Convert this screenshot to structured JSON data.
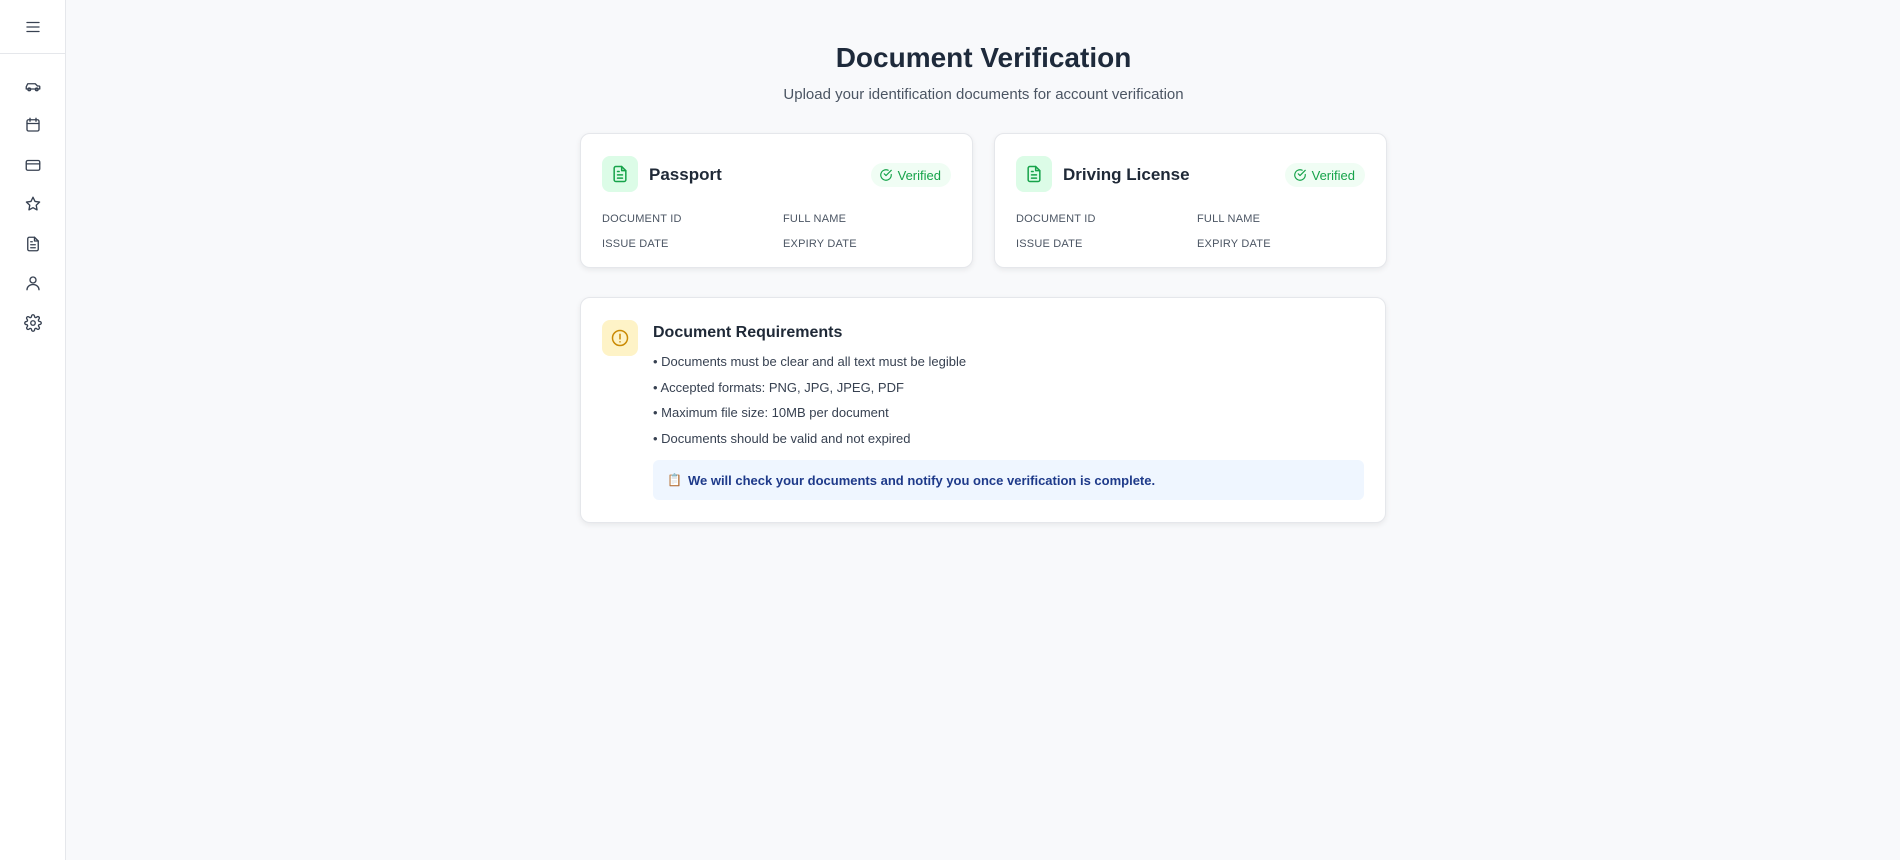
{
  "sidebar": {
    "menu_icon": "menu-icon",
    "items": [
      {
        "id": "vehicles",
        "icon": "car-icon"
      },
      {
        "id": "bookings",
        "icon": "calendar-icon"
      },
      {
        "id": "payments",
        "icon": "credit-card-icon"
      },
      {
        "id": "reviews",
        "icon": "star-icon"
      },
      {
        "id": "documents",
        "icon": "document-icon"
      },
      {
        "id": "profile",
        "icon": "user-icon"
      },
      {
        "id": "settings",
        "icon": "gear-icon"
      }
    ]
  },
  "header": {
    "title": "Document Verification",
    "subtitle": "Upload your identification documents for account verification"
  },
  "documents": [
    {
      "title": "Passport",
      "status": "Verified",
      "fields": {
        "document_id": "DOCUMENT ID",
        "full_name": "FULL NAME",
        "issue_date": "ISSUE DATE",
        "expiry_date": "EXPIRY DATE"
      }
    },
    {
      "title": "Driving License",
      "status": "Verified",
      "fields": {
        "document_id": "DOCUMENT ID",
        "full_name": "FULL NAME",
        "issue_date": "ISSUE DATE",
        "expiry_date": "EXPIRY DATE"
      }
    }
  ],
  "requirements": {
    "title": "Document Requirements",
    "items": [
      "• Documents must be clear and all text must be legible",
      "• Accepted formats: PNG, JPG, JPEG, PDF",
      "• Maximum file size: 10MB per document",
      "• Documents should be valid and not expired"
    ],
    "notice_icon": "📋",
    "notice": "We will check your documents and notify you once verification is complete."
  },
  "colors": {
    "verified": "#16a34a",
    "verified_bg": "#f0fdf4",
    "warning": "#ca8a04",
    "notice_bg": "#eff6ff",
    "notice_text": "#1e3a8a"
  }
}
